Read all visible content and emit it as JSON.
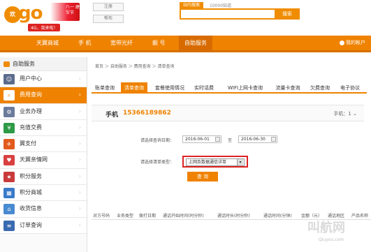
{
  "header": {
    "logo_circle_text": "欢",
    "logo_text": "go",
    "promo_text": "八一 建军节",
    "badge_4g": "4G，我来啦！",
    "login_button": "注册",
    "register_button": "帮布",
    "search_tab": "站内搜索",
    "hot_word": "10000知道",
    "search_button": "搜索"
  },
  "nav": {
    "items": [
      "天翼商城",
      "手 机",
      "宽带光纤",
      "靓 号",
      "自助服务"
    ],
    "account": "我的帐户"
  },
  "sidebar": {
    "title": "自助服务",
    "items": [
      {
        "label": "用户中心",
        "icon_color": "#5b6b8c",
        "icon": "user-icon"
      },
      {
        "label": "费用查询",
        "icon_color": "#ef8200",
        "icon": "search-icon",
        "active": true
      },
      {
        "label": "业务办理",
        "icon_color": "#6b7b9c",
        "icon": "gear-icon"
      },
      {
        "label": "充值交费",
        "icon_color": "#2e9a46",
        "icon": "yuan-icon"
      },
      {
        "label": "翼支付",
        "icon_color": "#e25a1c",
        "icon": "pay-icon"
      },
      {
        "label": "天翼亲情网",
        "icon_color": "#d94040",
        "icon": "family-icon"
      },
      {
        "label": "积分服务",
        "icon_color": "#c93a3a",
        "icon": "points-icon"
      },
      {
        "label": "积分商城",
        "icon_color": "#3a7ac9",
        "icon": "mall-icon"
      },
      {
        "label": "收货信息",
        "icon_color": "#4a8ad0",
        "icon": "address-icon"
      },
      {
        "label": "订单查询",
        "icon_color": "#3a6ab0",
        "icon": "order-icon"
      }
    ]
  },
  "breadcrumb": "首页 ＞ 自助服务 ＞ 费用查询 ＞ 清单查询",
  "tabs": [
    "账单查询",
    "清单查询",
    "套餐使用情况",
    "实时话费",
    "WIFI上网卡查询",
    "流量卡查询",
    "欠费查询",
    "电子协议"
  ],
  "phone": {
    "label": "手机",
    "number": "15366189862",
    "count": "手机：1"
  },
  "form": {
    "date_label": "请选择查询日期：",
    "date_from": "2016-06-01",
    "date_to_label": "至",
    "date_to": "2016-06-30",
    "type_label": "请选择清单类型：",
    "type_value": "上网及数据通信详单",
    "query_button": "查 询"
  },
  "table_headers": [
    "对方号码",
    "业务类型",
    "拨打日期",
    "通话开始时间(时分秒)",
    "通话时长(时分秒)",
    "通话时间(分钟)",
    "金额（元）",
    "通话地区",
    "产品名称"
  ],
  "watermark": "叫航网",
  "watermark_url": "Qiuyou.com"
}
